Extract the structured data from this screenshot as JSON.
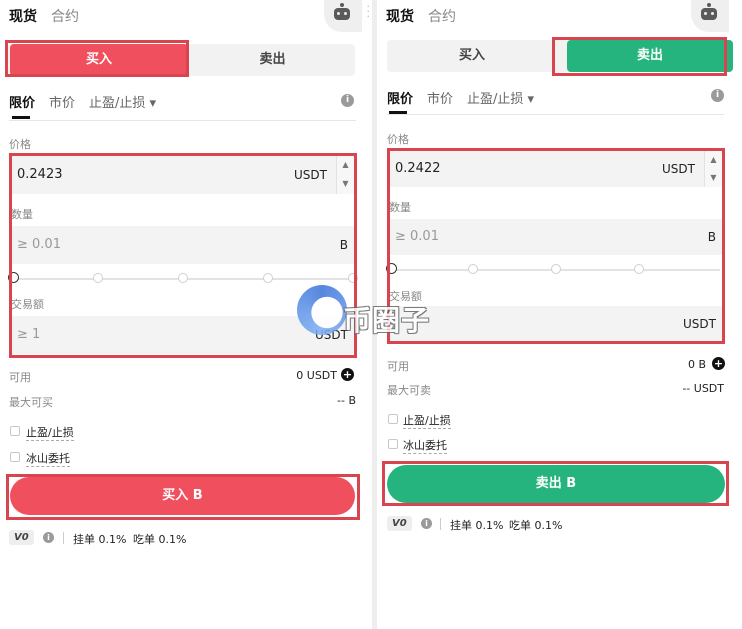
{
  "left": {
    "top_tabs": [
      "现货",
      "合约"
    ],
    "toggle": {
      "buy": "买入",
      "sell": "卖出"
    },
    "order_tabs": [
      "限价",
      "市价",
      "止盈/止损 ▾"
    ],
    "price_label": "价格",
    "price_value": "0.2423",
    "price_unit": "USDT",
    "qty_label": "数量",
    "qty_placeholder": "≥ 0.01",
    "qty_unit": "B",
    "amount_label": "交易额",
    "amount_placeholder": "≥ 1",
    "amount_unit": "USDT",
    "available_label": "可用",
    "available_value": "0 USDT",
    "max_label": "最大可买",
    "max_value": "-- B",
    "tp_sl_label": "止盈/止损",
    "iceberg_label": "冰山委托",
    "action_button": "买入 B",
    "vip": "V0",
    "maker_fee": "挂单 0.1%",
    "taker_fee": "吃单 0.1%"
  },
  "right": {
    "top_tabs": [
      "现货",
      "合约"
    ],
    "toggle": {
      "buy": "买入",
      "sell": "卖出"
    },
    "order_tabs": [
      "限价",
      "市价",
      "止盈/止损 ▾"
    ],
    "price_label": "价格",
    "price_value": "0.2422",
    "price_unit": "USDT",
    "qty_label": "数量",
    "qty_placeholder": "≥ 0.01",
    "qty_unit": "B",
    "amount_label": "交易额",
    "amount_unit": "USDT",
    "available_label": "可用",
    "available_value": "0 B",
    "max_label": "最大可卖",
    "max_value": "-- USDT",
    "tp_sl_label": "止盈/止损",
    "iceberg_label": "冰山委托",
    "action_button": "卖出 B",
    "vip": "V0",
    "maker_fee": "挂单 0.1%",
    "taker_fee": "吃单 0.1%"
  },
  "watermark": {
    "text": "币圈子"
  },
  "colors": {
    "buy": "#f0505e",
    "sell": "#26b47e",
    "highlight": "#d9454f"
  },
  "icons": [
    "robot-icon",
    "info-icon",
    "plus-circle-icon",
    "chevron-down-icon"
  ]
}
